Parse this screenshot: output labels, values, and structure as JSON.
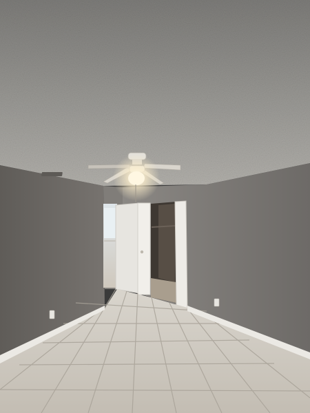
{
  "scene": {
    "colors": {
      "ceiling": "#8f8e8b",
      "ceiling_light": "#a9a8a4",
      "wall_left": "#6d6a66",
      "wall_right": "#7b7875",
      "wall_back": "#86837f",
      "baseboard": "#e6e4df",
      "floor_tile": "#cfcac1",
      "grout": "#a9a39a",
      "door": "#e9e7e2",
      "closet_dark": "#3c3630",
      "lamp_glow": "#fff3d6"
    },
    "icons": [
      "ceiling-fan-icon",
      "light-bulb-icon",
      "outlet-icon",
      "air-vent-icon"
    ]
  }
}
